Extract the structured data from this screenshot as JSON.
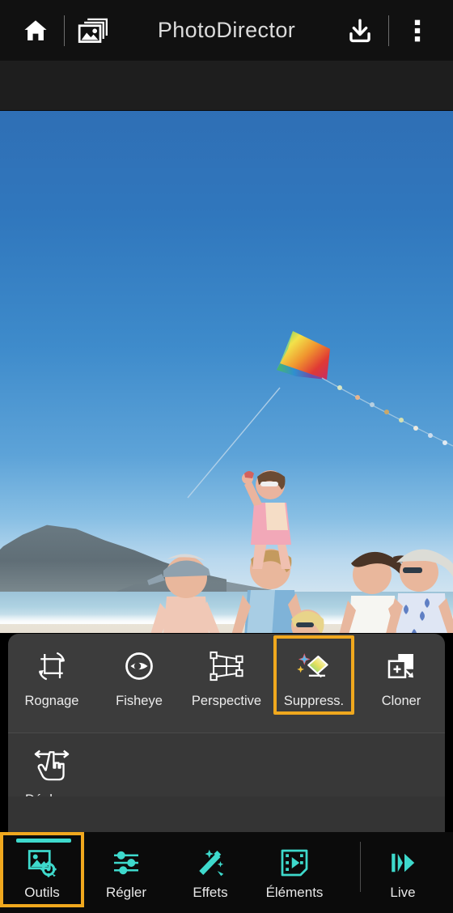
{
  "app": {
    "title": "PhotoDirector"
  },
  "topbar": {
    "home_icon": "home-icon",
    "library_icon": "photo-stack-icon",
    "download_icon": "download-icon",
    "menu_icon": "kebab-menu-icon"
  },
  "photo": {
    "description": "Family walking on a beach flying a rainbow kite",
    "sky_color": "#3077bd",
    "sand_color": "#ded6c7"
  },
  "tools": {
    "selected": "Suppress.",
    "highlight_color": "#f0a81e",
    "items": [
      {
        "label": "Rognage",
        "icon": "crop-rotate-icon",
        "selected": false
      },
      {
        "label": "Fisheye",
        "icon": "fisheye-eye-icon",
        "selected": false
      },
      {
        "label": "Perspective",
        "icon": "perspective-grid-icon",
        "selected": false
      },
      {
        "label": "Suppress.",
        "icon": "magic-eraser-icon",
        "selected": true
      },
      {
        "label": "Cloner",
        "icon": "clone-stamp-icon",
        "selected": false
      },
      {
        "label": "Déplacer",
        "icon": "move-hand-icon",
        "selected": false
      }
    ]
  },
  "bottom_nav": {
    "active": "Outils",
    "accent_color": "#3ed9cc",
    "highlight_color": "#f0a81e",
    "items": [
      {
        "label": "Outils",
        "icon": "image-gear-icon",
        "active": true
      },
      {
        "label": "Régler",
        "icon": "sliders-icon",
        "active": false
      },
      {
        "label": "Effets",
        "icon": "magic-wand-icon",
        "active": false
      },
      {
        "label": "Éléments",
        "icon": "film-play-icon",
        "active": false
      },
      {
        "label": "Live",
        "icon": "live-play-icon",
        "active": false
      }
    ]
  }
}
